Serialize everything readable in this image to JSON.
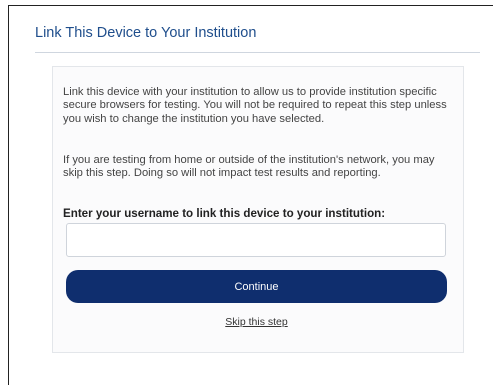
{
  "page": {
    "title": "Link This Device to Your Institution"
  },
  "panel": {
    "paragraph_1": "Link this device with your institution to allow us to provide institution specific secure browsers for testing. You will not be required to repeat this step unless you wish to change the institution you have selected.",
    "paragraph_2": "If you are testing from home or outside of the institution's network, you may skip this step. Doing so will not impact test results and reporting.",
    "prompt": "Enter your username to link this device to your institution:",
    "username_value": "",
    "username_placeholder": "",
    "continue_label": "Continue",
    "skip_label": "Skip this step"
  },
  "colors": {
    "title": "#1f4e8c",
    "button": "#0f2e6e",
    "button_text": "#ffffff"
  }
}
